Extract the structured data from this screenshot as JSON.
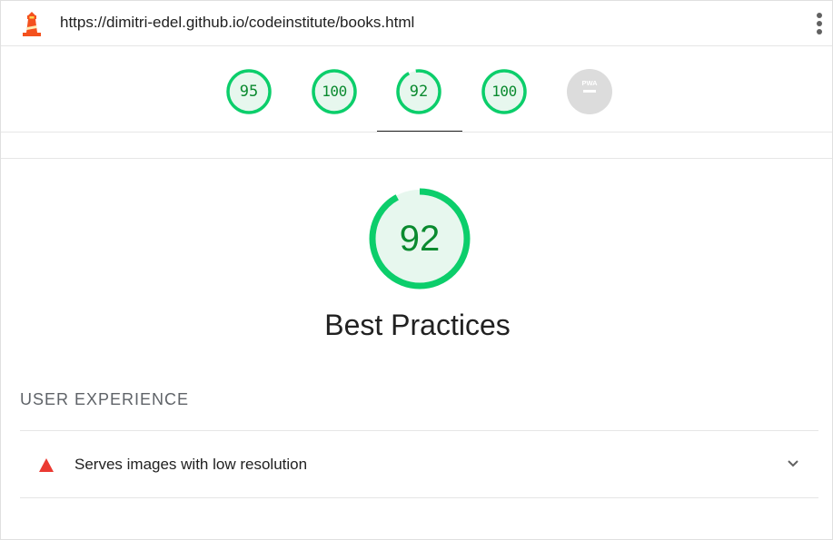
{
  "header": {
    "url": "https://dimitri-edel.github.io/codeinstitute/books.html",
    "logo_icon": "lighthouse-icon",
    "menu_icon": "kebab-menu-icon"
  },
  "gauges": [
    {
      "id": "performance",
      "score": "95"
    },
    {
      "id": "accessibility",
      "score": "100"
    },
    {
      "id": "best-practices",
      "score": "92",
      "active": true
    },
    {
      "id": "seo",
      "score": "100"
    },
    {
      "id": "pwa",
      "label": "PWA"
    }
  ],
  "category": {
    "score": "92",
    "score_value": 0.92,
    "title": "Best Practices"
  },
  "groups": [
    {
      "title": "USER EXPERIENCE",
      "audits": [
        {
          "title": "Serves images with low resolution",
          "status": "fail",
          "icon": "fail-triangle-icon",
          "expand_icon": "chevron-down-icon"
        }
      ]
    }
  ],
  "colors": {
    "pass_ring": "#0cce6b",
    "pass_fill": "#e7f7ee",
    "pass_text": "#0a8a2f",
    "fail": "#eb3a32",
    "pwa_gray": "#dcdcdc",
    "divider": "#e6e6e6"
  }
}
